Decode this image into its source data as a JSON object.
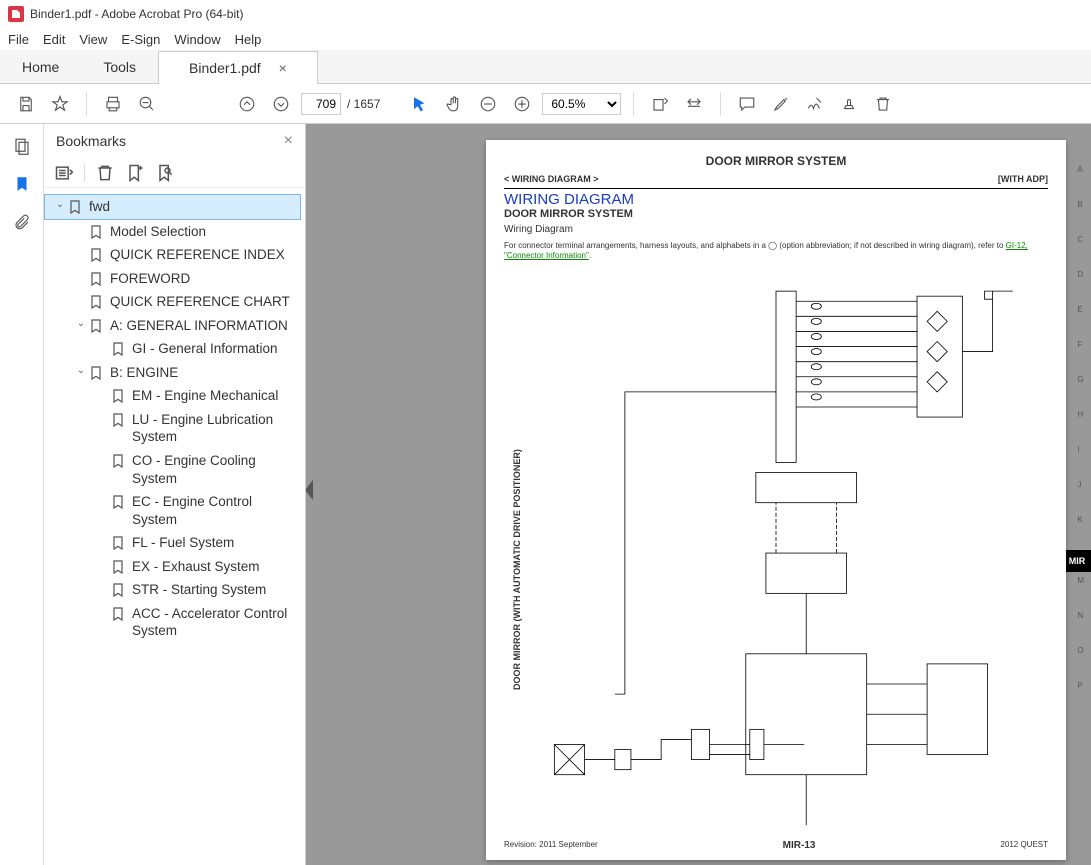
{
  "title": "Binder1.pdf - Adobe Acrobat Pro (64-bit)",
  "menu": [
    "File",
    "Edit",
    "View",
    "E-Sign",
    "Window",
    "Help"
  ],
  "tabs": {
    "home": "Home",
    "tools": "Tools",
    "doc": "Binder1.pdf"
  },
  "page_current": "709",
  "page_total": "/  1657",
  "zoom": "60.5%",
  "bookmarks_title": "Bookmarks",
  "bookmarks": [
    {
      "label": "fwd",
      "level": 0,
      "caret": "down",
      "selected": true
    },
    {
      "label": "Model Selection",
      "level": 1
    },
    {
      "label": "QUICK REFERENCE INDEX",
      "level": 1
    },
    {
      "label": "FOREWORD",
      "level": 1
    },
    {
      "label": "QUICK REFERENCE CHART",
      "level": 1
    },
    {
      "label": "A: GENERAL INFORMATION",
      "level": 1,
      "caret": "down"
    },
    {
      "label": "GI - General Information",
      "level": 2
    },
    {
      "label": "B: ENGINE",
      "level": 1,
      "caret": "down"
    },
    {
      "label": "EM - Engine Mechanical",
      "level": 2
    },
    {
      "label": "LU - Engine Lubrication System",
      "level": 2
    },
    {
      "label": "CO - Engine Cooling System",
      "level": 2
    },
    {
      "label": "EC - Engine Control System",
      "level": 2
    },
    {
      "label": "FL - Fuel System",
      "level": 2
    },
    {
      "label": "EX - Exhaust System",
      "level": 2
    },
    {
      "label": "STR - Starting System",
      "level": 2
    },
    {
      "label": "ACC - Accelerator Control System",
      "level": 2
    }
  ],
  "doc": {
    "system": "DOOR MIRROR SYSTEM",
    "breadcrumb": "< WIRING DIAGRAM >",
    "withadp": "[WITH ADP]",
    "h1": "WIRING DIAGRAM",
    "h2": "DOOR MIRROR SYSTEM",
    "h3": "Wiring Diagram",
    "note1": "For connector terminal arrangements, harness layouts, and alphabets in a",
    "note2": "(option abbreviation; if not described in wiring diagram), refer to ",
    "link": "GI-12, \"Connector Information\"",
    "rotated": "DOOR MIRROR (WITH AUTOMATIC DRIVE POSITIONER)",
    "letters": [
      "A",
      "B",
      "C",
      "D",
      "E",
      "F",
      "G",
      "H",
      "I",
      "J",
      "K",
      "",
      "M",
      "N",
      "O",
      "P"
    ],
    "mirtab": "MIR",
    "footer_l": "Revision: 2011 September",
    "footer_c": "MIR-13",
    "footer_r": "2012 QUEST"
  }
}
